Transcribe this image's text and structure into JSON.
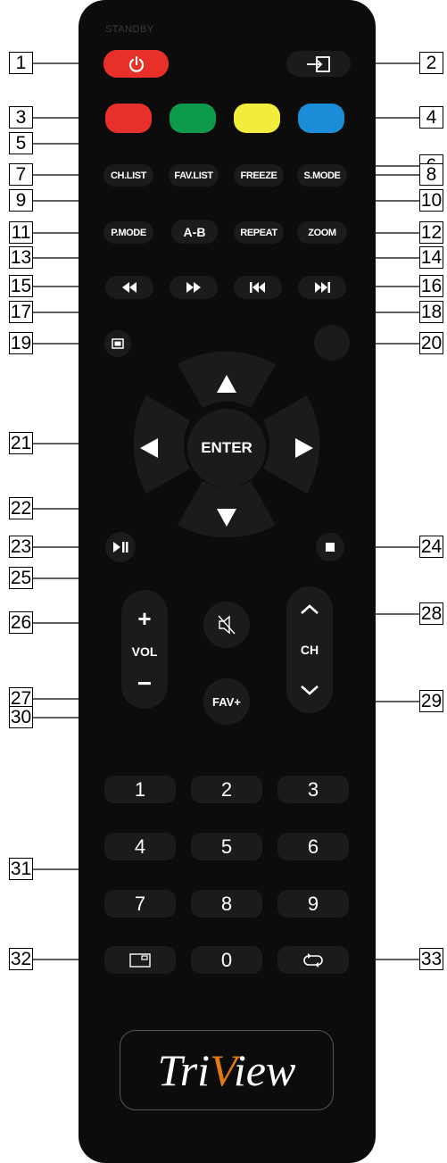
{
  "standby_label": "STANDBY",
  "buttons": {
    "ch_list": "CH.LIST",
    "fav_list": "FAV.LIST",
    "freeze": "FREEZE",
    "s_mode": "S.MODE",
    "p_mode": "P.MODE",
    "a_b": "A-B",
    "repeat": "REPEAT",
    "zoom": "ZOOM",
    "enter": "ENTER",
    "vol": "VOL",
    "vol_plus": "+",
    "vol_minus": "−",
    "ch": "CH",
    "fav_plus": "FAV+"
  },
  "numbers": [
    "1",
    "2",
    "3",
    "4",
    "5",
    "6",
    "7",
    "8",
    "9",
    "0"
  ],
  "colors": {
    "power": "#e8302a",
    "red": "#e8302a",
    "green": "#0d9a4c",
    "yellow": "#f4ec3c",
    "blue": "#1a8cd8",
    "logo_accent": "#e07a10"
  },
  "icons": [
    "power-icon",
    "input-source-icon",
    "rewind-icon",
    "fast-forward-icon",
    "previous-track-icon",
    "next-track-icon",
    "screen-icon",
    "arrow-up-icon",
    "arrow-down-icon",
    "arrow-left-icon",
    "arrow-right-icon",
    "play-pause-icon",
    "stop-icon",
    "mute-icon",
    "chevron-up-icon",
    "chevron-down-icon",
    "aspect-icon",
    "return-icon"
  ],
  "callouts": [
    "1",
    "2",
    "3",
    "4",
    "5",
    "6",
    "7",
    "8",
    "9",
    "10",
    "11",
    "12",
    "13",
    "14",
    "15",
    "16",
    "17",
    "18",
    "19",
    "20",
    "21",
    "22",
    "23",
    "24",
    "25",
    "26",
    "27",
    "28",
    "29",
    "30",
    "31",
    "32",
    "33"
  ],
  "logo": {
    "part1": "Tri",
    "part2": "V",
    "part3": "iew"
  }
}
